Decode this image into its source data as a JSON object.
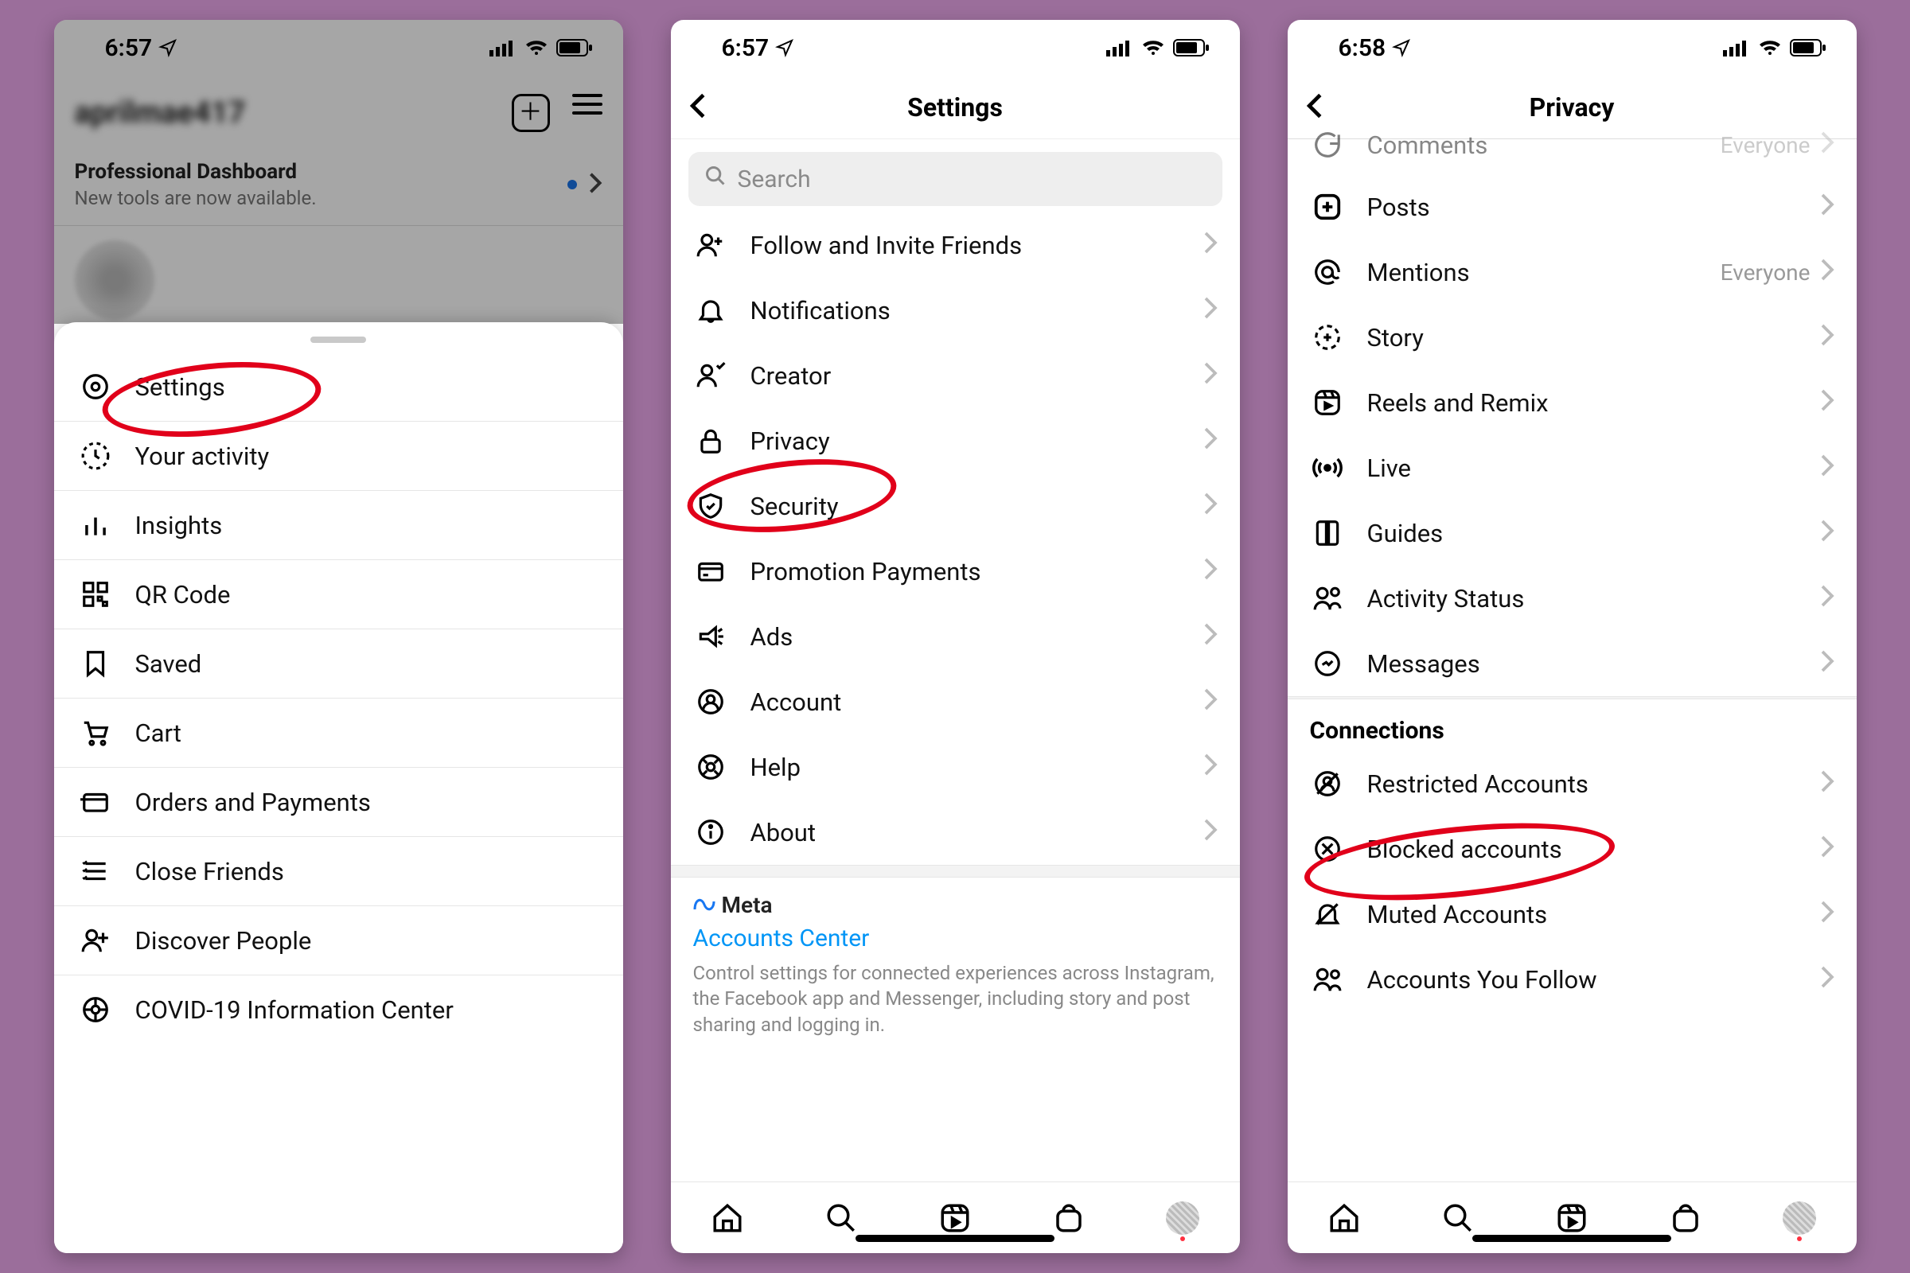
{
  "screen1": {
    "time": "6:57",
    "username": "aprilmae417",
    "dash_title": "Professional Dashboard",
    "dash_sub": "New tools are now available.",
    "items": [
      {
        "icon": "gear",
        "label": "Settings"
      },
      {
        "icon": "activity",
        "label": "Your activity"
      },
      {
        "icon": "insights",
        "label": "Insights"
      },
      {
        "icon": "qr",
        "label": "QR Code"
      },
      {
        "icon": "saved",
        "label": "Saved"
      },
      {
        "icon": "cart",
        "label": "Cart"
      },
      {
        "icon": "card",
        "label": "Orders and Payments"
      },
      {
        "icon": "close-friends",
        "label": "Close Friends"
      },
      {
        "icon": "discover",
        "label": "Discover People"
      },
      {
        "icon": "covid",
        "label": "COVID-19 Information Center"
      }
    ]
  },
  "screen2": {
    "time": "6:57",
    "title": "Settings",
    "search_placeholder": "Search",
    "items": [
      {
        "icon": "follow",
        "label": "Follow and Invite Friends"
      },
      {
        "icon": "notifications",
        "label": "Notifications"
      },
      {
        "icon": "creator",
        "label": "Creator"
      },
      {
        "icon": "privacy",
        "label": "Privacy"
      },
      {
        "icon": "security",
        "label": "Security"
      },
      {
        "icon": "payments",
        "label": "Promotion Payments"
      },
      {
        "icon": "ads",
        "label": "Ads"
      },
      {
        "icon": "account",
        "label": "Account"
      },
      {
        "icon": "help",
        "label": "Help"
      },
      {
        "icon": "about",
        "label": "About"
      }
    ],
    "meta_brand": "Meta",
    "meta_link": "Accounts Center",
    "meta_desc": "Control settings for connected experiences across Instagram, the Facebook app and Messenger, including story and post sharing and logging in."
  },
  "screen3": {
    "time": "6:58",
    "title": "Privacy",
    "top_partial": {
      "icon": "comments",
      "label": "Comments",
      "trail": "Everyone"
    },
    "items_a": [
      {
        "icon": "posts",
        "label": "Posts"
      },
      {
        "icon": "mentions",
        "label": "Mentions",
        "trail": "Everyone"
      },
      {
        "icon": "story",
        "label": "Story"
      },
      {
        "icon": "reels",
        "label": "Reels and Remix"
      },
      {
        "icon": "live",
        "label": "Live"
      },
      {
        "icon": "guides",
        "label": "Guides"
      },
      {
        "icon": "activity-status",
        "label": "Activity Status"
      },
      {
        "icon": "messages",
        "label": "Messages"
      }
    ],
    "section_b": "Connections",
    "items_b": [
      {
        "icon": "restricted",
        "label": "Restricted Accounts"
      },
      {
        "icon": "blocked",
        "label": "Blocked accounts"
      },
      {
        "icon": "muted",
        "label": "Muted Accounts"
      },
      {
        "icon": "follow-you",
        "label": "Accounts You Follow"
      }
    ]
  },
  "icons_svg": {
    "chevron": "<svg viewBox='0 0 12 20' fill='none' stroke='#bcbcbc' stroke-width='2.5'><polyline points='2,2 10,10 2,18'/></svg>",
    "chevron-dark": "<svg viewBox='0 0 12 20' fill='none' stroke='#444' stroke-width='2.8'><polyline points='2,2 10,10 2,18'/></svg>",
    "back": "<svg width='28' height='34' viewBox='0 0 12 20' fill='none' stroke='#000' stroke-width='2.8'><polyline points='10,2 2,10 10,18'/></svg>",
    "loc-arrow": "<svg width='24' height='24' viewBox='0 0 24 24' fill='none' stroke='#000' stroke-width='2'><path d='M3 11 L21 3 L13 21 L11 13 Z'/></svg>",
    "signal": "<svg width='34' height='22' viewBox='0 0 34 22'><rect x='0' y='14' width='5' height='8' fill='#000'/><rect x='8' y='10' width='5' height='12' fill='#000'/><rect x='16' y='6' width='5' height='16' fill='#000'/><rect x='24' y='2' width='5' height='20' fill='#000'/></svg>",
    "wifi": "<svg width='30' height='22' viewBox='0 0 30 22' fill='#000'><path d='M15 20a2 2 0 100-4 2 2 0 000 4zM7 12a12 12 0 0116 0l-3 3a8 8 0 00-10 0zM2 7a20 20 0 0126 0l-3 3a16 16 0 00-20 0z'/></svg>",
    "battery": "<svg width='46' height='22' viewBox='0 0 46 22'><rect x='1' y='1' width='38' height='20' rx='5' fill='none' stroke='#000' stroke-width='2'/><rect x='4' y='4' width='26' height='14' rx='2' fill='#000'/><rect x='41' y='7' width='4' height='8' rx='2' fill='#000'/></svg>",
    "search": "<svg width='28' height='28' viewBox='0 0 24 24' fill='none' stroke='#8a8a8a' stroke-width='2.5'><circle cx='10' cy='10' r='7'/><line x1='15' y1='15' x2='21' y2='21'/></svg>",
    "home": "<svg width='42' height='42' viewBox='0 0 24 24' fill='none' stroke='#000' stroke-width='2'><path d='M3 11 L12 3 L21 11 V21 H3 Z'/><path d='M9 21 V14 H15 V21'/></svg>",
    "search-tab": "<svg width='42' height='42' viewBox='0 0 24 24' fill='none' stroke='#000' stroke-width='2'><circle cx='10' cy='10' r='7'/><line x1='15' y1='15' x2='21' y2='21'/></svg>",
    "reels-tab": "<svg width='42' height='42' viewBox='0 0 24 24' fill='none' stroke='#000' stroke-width='2'><rect x='3' y='3' width='18' height='18' rx='5'/><path d='M3 8 H21 M9 3 L11 8 M15 3 L17 8'/><path d='M10 12 L15 15 L10 18 Z' fill='#000'/></svg>",
    "shop-tab": "<svg width='42' height='42' viewBox='0 0 24 24' fill='none' stroke='#000' stroke-width='2'><rect x='4' y='7' width='16' height='14' rx='4'/><path d='M8 7 a4 4 0 0 1 8 0'/></svg>",
    "gear": "<svg width='38' height='38' viewBox='0 0 24 24' fill='none' stroke='#000' stroke-width='2'><circle cx='12' cy='12' r='9'/><circle cx='12' cy='12' r='3'/></svg>",
    "activity": "<svg width='38' height='38' viewBox='0 0 24 24' fill='none' stroke='#000' stroke-width='2'><circle cx='12' cy='12' r='10' stroke-dasharray='3 3'/><path d='M12 7 V12 L15 14'/></svg>",
    "insights": "<svg width='38' height='38' viewBox='0 0 24 24' fill='none' stroke='#000' stroke-width='2.2'><line x1='5' y1='20' x2='5' y2='12'/><line x1='12' y1='20' x2='12' y2='6'/><line x1='19' y1='20' x2='19' y2='14'/></svg>",
    "qr": "<svg width='38' height='38' viewBox='0 0 24 24' fill='none' stroke='#000' stroke-width='2'><rect x='3' y='3' width='7' height='7'/><rect x='14' y='3' width='7' height='7'/><rect x='3' y='14' width='7' height='7'/><rect x='14' y='14' width='3' height='3'/><rect x='18' y='18' width='3' height='3'/></svg>",
    "saved": "<svg width='38' height='38' viewBox='0 0 24 24' fill='none' stroke='#000' stroke-width='2'><path d='M6 3 H18 V21 L12 16 L6 21 Z'/></svg>",
    "cart": "<svg width='38' height='38' viewBox='0 0 24 24' fill='none' stroke='#000' stroke-width='2'><circle cx='9' cy='20' r='1.5'/><circle cx='18' cy='20' r='1.5'/><path d='M3 4 H6 L9 15 H19 L21 8 H7'/></svg>",
    "card": "<svg width='38' height='38' viewBox='0 0 24 24' fill='none' stroke='#000' stroke-width='2'><rect x='3' y='6' width='18' height='13' rx='2'/><line x='3' y1='10' x2='21' y2='10'/></svg>",
    "close-friends": "<svg width='38' height='38' viewBox='0 0 24 24' fill='none' stroke='#000' stroke-width='2'><line x1='4' y1='6' x2='20' y2='6'/><line x1='4' y1='12' x2='20' y2='12'/><line x1='4' y1='18' x2='20' y2='18'/><path d='M2 5 L3 6 L5 4 M2 11 L3 12 L5 10 M2 17 L3 18 L5 16' stroke-width='1.5'/></svg>",
    "discover": "<svg width='38' height='38' viewBox='0 0 24 24' fill='none' stroke='#000' stroke-width='2'><circle cx='9' cy='8' r='4'/><path d='M2 21 a7 7 0 0 1 14 0'/><line x1='18' y1='6' x2='18' y2='14'/><line x1='14' y1='10' x2='22' y2='10'/></svg>",
    "covid": "<svg width='38' height='38' viewBox='0 0 24 24' fill='none' stroke='#000' stroke-width='2'><circle cx='12' cy='12' r='9'/><circle cx='12' cy='12' r='3'/><line x1='12' y1='3' x2='12' y2='9' /><line x1='12' y1='15' x2='12' y2='21'/><line x1='3' y1='12' x2='9' y2='12'/><line x1='15' y1='12' x2='21' y2='12'/></svg>",
    "follow": "<svg width='38' height='38' viewBox='0 0 24 24' fill='none' stroke='#000' stroke-width='2'><circle cx='9' cy='8' r='4'/><path d='M2 21 a7 7 0 0 1 14 0'/><line x1='18' y1='6' x2='18' y2='12'/><line x1='15' y1='9' x2='21' y2='9'/></svg>",
    "notifications": "<svg width='38' height='38' viewBox='0 0 24 24' fill='none' stroke='#000' stroke-width='2'><path d='M6 16 V11 a6 6 0 0 1 12 0 V16 L20 19 H4 Z'/><path d='M10 19 a2 2 0 0 0 4 0'/></svg>",
    "creator": "<svg width='38' height='38' viewBox='0 0 24 24' fill='none' stroke='#000' stroke-width='2'><circle cx='9' cy='8' r='4'/><path d='M2 21 a7 7 0 0 1 14 0'/><path d='M17 4 L19 6 L23 2' /></svg>",
    "privacy": "<svg width='38' height='38' viewBox='0 0 24 24' fill='none' stroke='#000' stroke-width='2'><rect x='5' y='11' width='14' height='10' rx='2'/><path d='M8 11 V8 a4 4 0 0 1 8 0 V11'/></svg>",
    "security": "<svg width='38' height='38' viewBox='0 0 24 24' fill='none' stroke='#000' stroke-width='2'><path d='M12 3 L20 6 V11 C20 16 16 20 12 21 C8 20 4 16 4 11 V6 Z'/><path d='M9 12 L11 14 L15 10'/></svg>",
    "payments": "<svg width='38' height='38' viewBox='0 0 24 24' fill='none' stroke='#000' stroke-width='2'><rect x='3' y='6' width='18' height='13' rx='2'/><line x1='3' y1='10' x2='21' y2='10'/><line x1='6' y1='15' x2='10' y2='15'/></svg>",
    "ads": "<svg width='38' height='38' viewBox='0 0 24 24' fill='none' stroke='#000' stroke-width='2'><path d='M4 10 H10 L16 5 V19 L10 14 H4 Z'/><line x1='18' y1='8' x2='21' y2='6'/><line x1='18' y1='12' x2='22' y2='12'/><line x1='18' y1='16' x2='21' y2='18'/></svg>",
    "account": "<svg width='38' height='38' viewBox='0 0 24 24' fill='none' stroke='#000' stroke-width='2'><circle cx='12' cy='12' r='9'/><circle cx='12' cy='10' r='3'/><path d='M6 19 a6 6 0 0 1 12 0'/></svg>",
    "help": "<svg width='38' height='38' viewBox='0 0 24 24' fill='none' stroke='#000' stroke-width='2'><circle cx='12' cy='12' r='9'/><circle cx='12' cy='12' r='3'/><line x1='5' y1='5' x2='9' y2='9'/><line x1='15' y1='15' x2='19' y2='19'/><line x1='15' y1='9' x2='19' y2='5'/><line x1='5' y1='19' x2='9' y2='15'/></svg>",
    "about": "<svg width='38' height='38' viewBox='0 0 24 24' fill='none' stroke='#000' stroke-width='2'><circle cx='12' cy='12' r='9'/><line x1='12' y1='11' x2='12' y2='17'/><circle cx='12' cy='7.5' r='1' fill='#000'/></svg>",
    "comments": "<svg width='38' height='38' viewBox='0 0 24 24' fill='none' stroke='#000' stroke-width='2'><path d='M21 12 a9 9 0 1 1 -3 -6.7'/><path d='M21 4 V11 H14'/></svg>",
    "posts": "<svg width='38' height='38' viewBox='0 0 24 24' fill='none' stroke='#000' stroke-width='2.4'><rect x='3' y='3' width='18' height='18' rx='5'/><line x1='8' y1='12' x2='16' y2='12'/><line x1='12' y1='8' x2='12' y2='16'/></svg>",
    "mentions": "<svg width='38' height='38' viewBox='0 0 24 24' fill='none' stroke='#000' stroke-width='2'><circle cx='12' cy='12' r='4'/><path d='M16 12 v2 a3 3 0 0 0 5 2 M21 12 a9 9 0 1 0 -4 7.5'/></svg>",
    "story": "<svg width='38' height='38' viewBox='0 0 24 24' fill='none' stroke='#000' stroke-width='2'><circle cx='12' cy='12' r='9' stroke-dasharray='4 3'/><line x1='9' y1='12' x2='15' y2='12'/><line x1='12' y1='9' x2='12' y2='15'/></svg>",
    "reels": "<svg width='38' height='38' viewBox='0 0 24 24' fill='none' stroke='#000' stroke-width='2'><rect x='3' y='3' width='18' height='18' rx='5'/><path d='M3 8 H21 M9 3 L11 8 M15 3 L17 8'/><path d='M10 12 L15 14.5 L10 17 Z' fill='#000'/></svg>",
    "live": "<svg width='38' height='38' viewBox='0 0 24 24' fill='none' stroke='#000' stroke-width='2.2'><circle cx='12' cy='12' r='2' fill='#000'/><path d='M7 8 a6 6 0 0 0 0 8 M17 8 a6 6 0 0 1 0 8 M4 5 a10 10 0 0 0 0 14 M20 5 a10 10 0 0 1 0 14'/></svg>",
    "guides": "<svg width='38' height='38' viewBox='0 0 24 24' fill='none' stroke='#000' stroke-width='2'><path d='M4 5 a2 2 0 0 1 2 -2 H11 V21 H6 a2 2 0 0 1 -2 -2 Z'/><path d='M20 5 a2 2 0 0 0 -2 -2 H13 V21 H18 a2 2 0 0 0 2 -2 Z'/></svg>",
    "activity-status": "<svg width='38' height='38' viewBox='0 0 24 24' fill='none' stroke='#000' stroke-width='2'><circle cx='8' cy='8' r='4'/><path d='M2 21 a6 6 0 0 1 12 0'/><circle cx='18' cy='7' r='3'/><path d='M14 20 a4 4 0 0 1 8 0'/></svg>",
    "messages": "<svg width='38' height='38' viewBox='0 0 24 24' fill='none' stroke='#000' stroke-width='2'><circle cx='12' cy='12' r='9'/><path d='M8 13 L11 11 L13 13 L16 10'/></svg>",
    "restricted": "<svg width='38' height='38' viewBox='0 0 24 24' fill='none' stroke='#000' stroke-width='2'><circle cx='12' cy='12' r='9'/><circle cx='12' cy='10' r='3'/><path d='M7 18 a5 5 0 0 1 10 0'/><line x1='4' y1='20' x2='20' y2='4'/></svg>",
    "blocked": "<svg width='38' height='38' viewBox='0 0 24 24' fill='none' stroke='#000' stroke-width='2'><circle cx='12' cy='12' r='9'/><line x1='8' y1='8' x2='16' y2='16'/><line x1='16' y1='8' x2='8' y2='16'/></svg>",
    "muted": "<svg width='38' height='38' viewBox='0 0 24 24' fill='none' stroke='#000' stroke-width='2'><path d='M6 16 V11 a6 6 0 0 1 12 0 V16 L20 19 H4 Z'/><line x1='4' y1='20' x2='20' y2='4'/></svg>",
    "follow-you": "<svg width='38' height='38' viewBox='0 0 24 24' fill='none' stroke='#000' stroke-width='2'><circle cx='8' cy='8' r='4'/><path d='M2 21 a6 6 0 0 1 12 0'/><circle cx='18' cy='8' r='3'/><path d='M14 21 a4 4 0 0 1 8 0'/></svg>",
    "meta": "<svg width='30' height='22' viewBox='0 0 30 22' fill='none' stroke='#1877f2' stroke-width='3'><path d='M2 18 C2 6 10 2 14 12 C18 22 26 18 26 8' /></svg>"
  }
}
